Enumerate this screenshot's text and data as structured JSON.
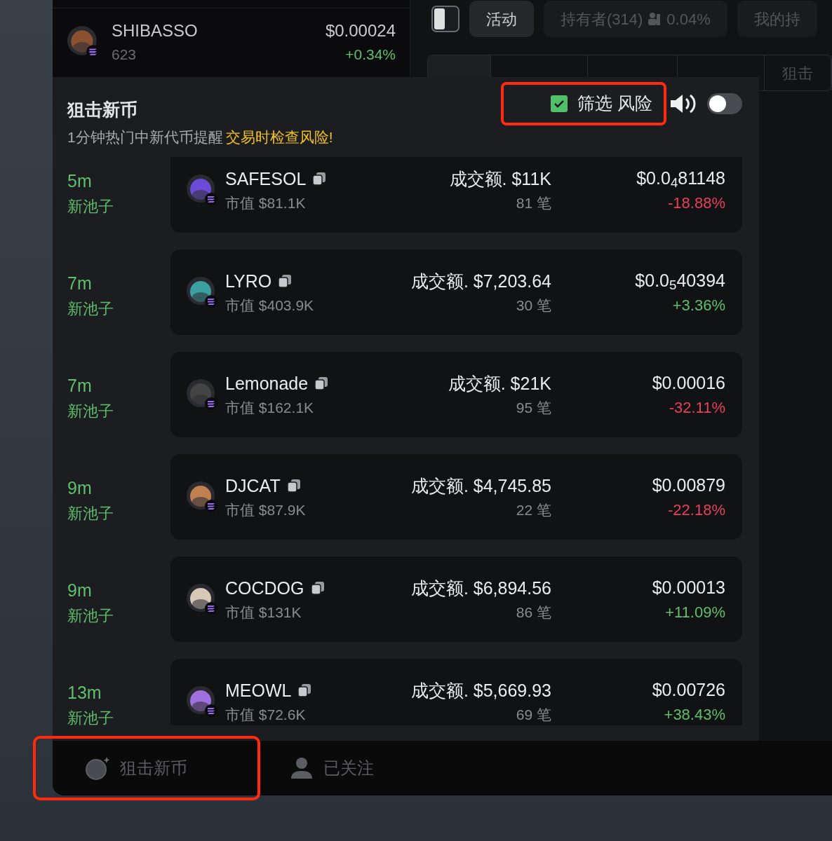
{
  "background_list": {
    "token": {
      "name": "SHIBASSO",
      "count": "623",
      "price": "$0.00024",
      "change": "+0.34%",
      "color": "#5fbf6b"
    }
  },
  "background_tabs": [
    {
      "label": "活动",
      "selected": true
    },
    {
      "label": "持有者(314)",
      "selected": false,
      "extra": "0.04%"
    },
    {
      "label": "我的持",
      "selected": false
    }
  ],
  "background_subtabs": [
    {
      "label": "狙击",
      "selected": false
    }
  ],
  "popup": {
    "title": "狙击新币",
    "subtitle": "1分钟热门中新代币提醒",
    "warning": "交易时检查风险!",
    "filter": {
      "label": "筛选 风险",
      "checked": true
    },
    "sound_toggle": {
      "on": false
    },
    "rows": [
      {
        "age": "5m",
        "tag": "新池子",
        "name": "SAFESOL",
        "market_cap": "市值 $81.1K",
        "volume": "成交额. $11K",
        "trades": "81 笔",
        "price": "$0.0$_{4}$81148",
        "change": "-18.88%",
        "color": "#e5415d"
      },
      {
        "age": "7m",
        "tag": "新池子",
        "name": "LYRO",
        "market_cap": "市值 $403.9K",
        "volume": "成交额. $7,203.64",
        "trades": "30 笔",
        "price": "$0.0$_{5}$40394",
        "change": "+3.36%",
        "color": "#5fbf6b"
      },
      {
        "age": "7m",
        "tag": "新池子",
        "name": "Lemonade",
        "market_cap": "市值 $162.1K",
        "volume": "成交额. $21K",
        "trades": "95 笔",
        "price": "$0.00016",
        "change": "-32.11%",
        "color": "#e5415d"
      },
      {
        "age": "9m",
        "tag": "新池子",
        "name": "DJCAT",
        "market_cap": "市值 $87.9K",
        "volume": "成交额. $4,745.85",
        "trades": "22 笔",
        "price": "$0.00879",
        "change": "-22.18%",
        "color": "#e5415d"
      },
      {
        "age": "9m",
        "tag": "新池子",
        "name": "COCDOG",
        "market_cap": "市值 $131K",
        "volume": "成交额. $6,894.56",
        "trades": "86 笔",
        "price": "$0.00013",
        "change": "+11.09%",
        "color": "#5fbf6b"
      },
      {
        "age": "13m",
        "tag": "新池子",
        "name": "MEOWL",
        "market_cap": "市值 $72.6K",
        "volume": "成交额. $5,669.93",
        "trades": "69 笔",
        "price": "$0.00726",
        "change": "+38.43%",
        "color": "#5fbf6b"
      }
    ]
  },
  "bottom_nav": [
    {
      "label": "狙击新币",
      "kind": "snipe"
    },
    {
      "label": "已关注",
      "kind": "user"
    }
  ]
}
